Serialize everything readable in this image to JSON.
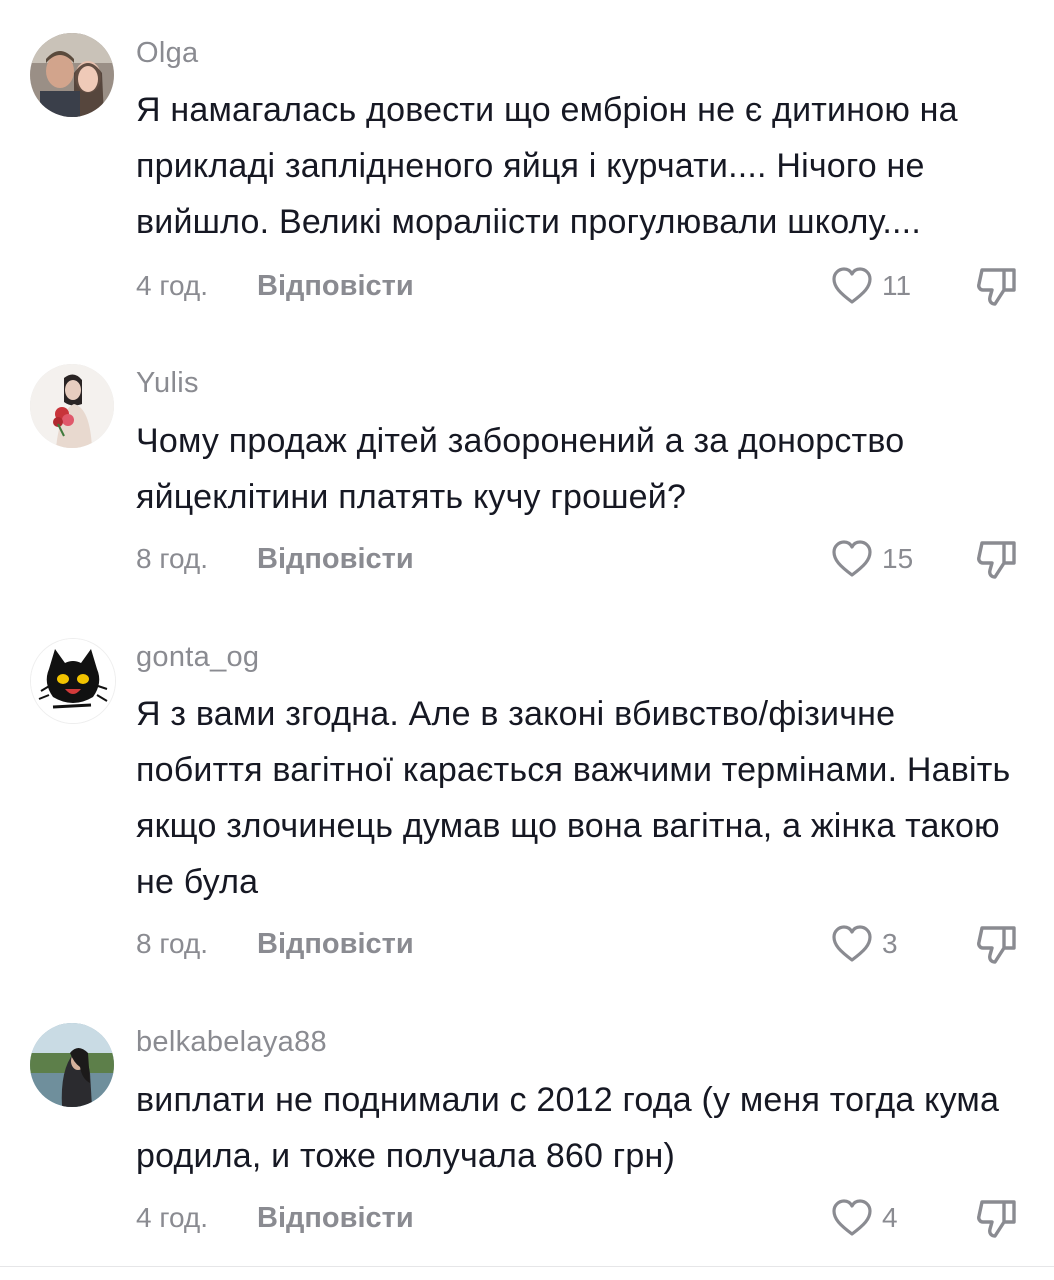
{
  "comments": [
    {
      "username": "Olga",
      "text": "Я намагалась довести що ембріон не є дитиною на прикладі заплідненого яйця і курчати.... Нічого не вийшло. Великі мораліісти прогулювали школу....",
      "time": "4 год.",
      "reply_label": "Відповісти",
      "likes": "11"
    },
    {
      "username": "Yulis",
      "text": "Чому продаж дітей заборонений а за донорство яйцеклітини платять кучу грошей?",
      "time": "8 год.",
      "reply_label": "Відповісти",
      "likes": "15"
    },
    {
      "username": "gonta_og",
      "text": "Я з вами згодна. Але в законі вбивство/фізичне побиття вагітної карається важчими термінами. Навіть якщо злочинець думав що вона вагітна, а жінка такою не була",
      "time": "8 год.",
      "reply_label": "Відповісти",
      "likes": "3"
    },
    {
      "username": "belkabelaya88",
      "text": "виплати не поднимали с 2012 года (у меня тогда кума родила, и тоже получала 860 грн)",
      "time": "4 год.",
      "reply_label": "Відповісти",
      "likes": "4"
    }
  ],
  "icons": {
    "like": "heart-outline-icon",
    "dislike": "thumbs-down-icon"
  },
  "colors": {
    "text": "#161823",
    "secondary": "#8a8b91"
  }
}
